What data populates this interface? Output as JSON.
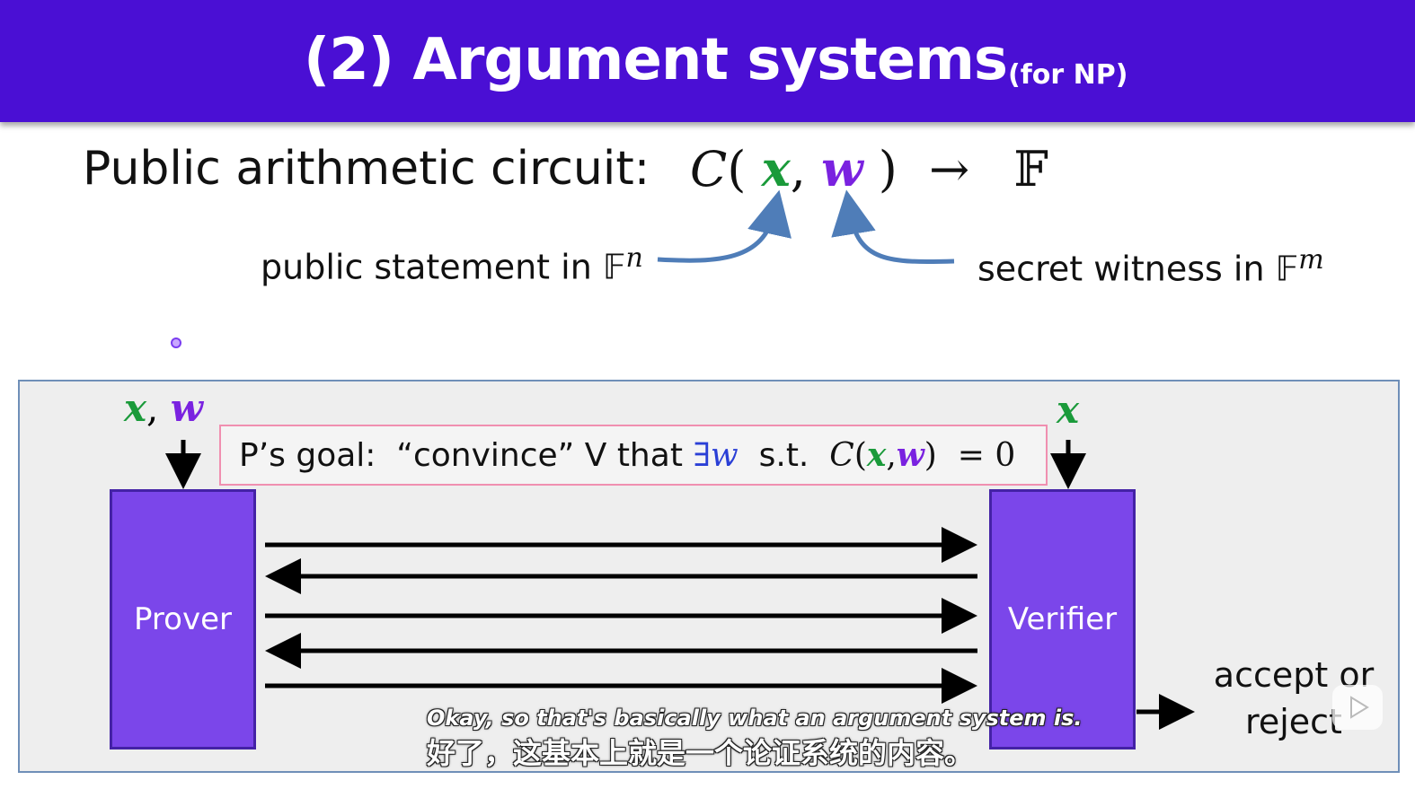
{
  "slide": {
    "title": "(2) Argument systems",
    "title_note": "(for NP)",
    "circuit_label": "Public arithmetic circuit:",
    "formula": {
      "C": "C",
      "open": "(",
      "x": "x",
      "comma": ",",
      "w": "w",
      "close": ")",
      "arrow": "→",
      "field": "𝔽"
    },
    "public_statement": {
      "text": "public statement in 𝔽",
      "exp": "n"
    },
    "secret_witness": {
      "text": "secret witness in 𝔽",
      "exp": "m"
    },
    "prover_inputs": {
      "x": "x",
      "sep": ",",
      "w": "w"
    },
    "verifier_input": "x",
    "goal": {
      "prefix": "P’s goal:  “convince” V that ",
      "exists": "∃",
      "w": "w",
      "st": "  s.t.  ",
      "C": "C",
      "lp": "(",
      "x": "x",
      "comma": ",",
      "w2": "w",
      "rp": ")",
      "eq": "  = 0"
    },
    "prover_label": "Prover",
    "verifier_label": "Verifier",
    "result_line1": "accept or",
    "result_line2": "reject"
  },
  "subtitles": {
    "english": "Okay, so that's basically what an argument system is.",
    "chinese": "好了，这基本上就是一个论证系统的内容。"
  },
  "colors": {
    "header_bg": "#4a0fd4",
    "box_fill": "#7b46ea",
    "statement_green": "#1a9a3a",
    "witness_purple": "#7a22e0",
    "curve_arrow_blue": "#4f7db8",
    "goal_border": "#f08fb0"
  },
  "icons": [
    "down-arrow-icon",
    "play-icon"
  ]
}
